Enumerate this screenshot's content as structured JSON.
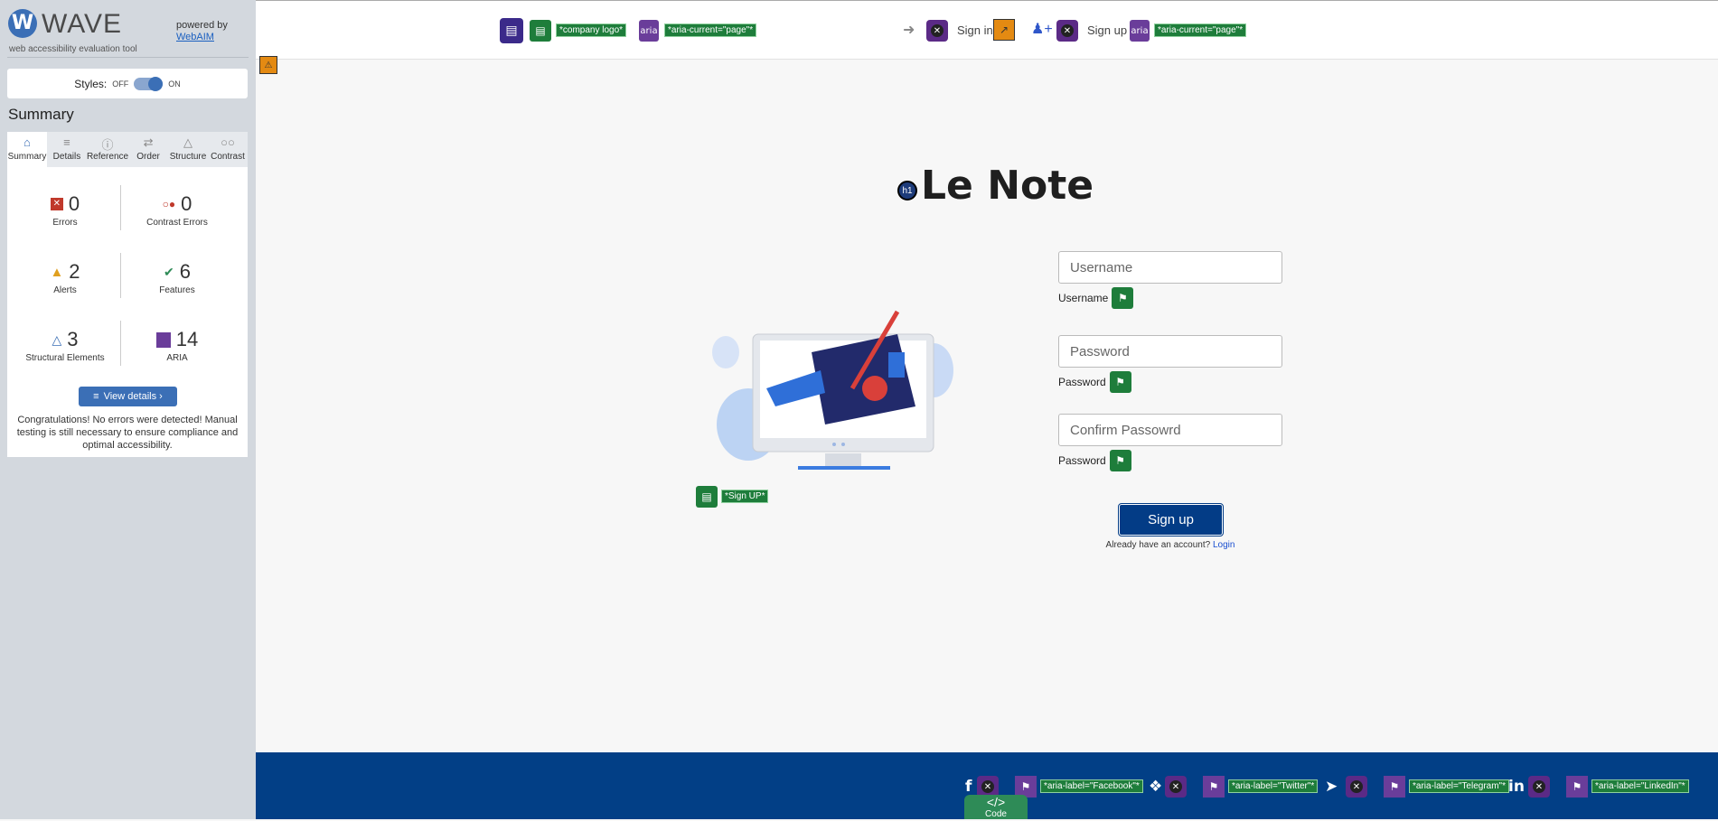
{
  "wave": {
    "title": "WAVE",
    "tagline": "web accessibility evaluation tool",
    "powered_by": "powered by",
    "webaim": "WebAIM",
    "styles_label": "Styles:",
    "styles_off": "OFF",
    "styles_on": "ON",
    "summary_heading": "Summary",
    "tabs": [
      {
        "label": "Summary",
        "icon": "home-icon"
      },
      {
        "label": "Details",
        "icon": "list-icon"
      },
      {
        "label": "Reference",
        "icon": "info-icon"
      },
      {
        "label": "Order",
        "icon": "order-icon"
      },
      {
        "label": "Structure",
        "icon": "structure-icon"
      },
      {
        "label": "Contrast",
        "icon": "contrast-icon"
      }
    ],
    "stats": {
      "errors": {
        "count": "0",
        "label": "Errors",
        "color": "#c0392b"
      },
      "contrast_errors": {
        "count": "0",
        "label": "Contrast Errors",
        "color": "#c0392b"
      },
      "alerts": {
        "count": "2",
        "label": "Alerts",
        "color": "#e0a020"
      },
      "features": {
        "count": "6",
        "label": "Features",
        "color": "#2e8b57"
      },
      "structural": {
        "count": "3",
        "label": "Structural Elements",
        "color": "#3b6fb6"
      },
      "aria": {
        "count": "14",
        "label": "ARIA",
        "color": "#6a3d9a"
      }
    },
    "view_details": "View details ›",
    "congrats": "Congratulations! No errors were detected! Manual testing is still necessary to ensure compliance and optimal accessibility."
  },
  "nav": {
    "logo_label": "*company logo*",
    "aria_current_1": "*aria-current=\"page\"*",
    "sign_in": "Sign in",
    "sign_up": "Sign up",
    "aria_current_2": "*aria-current=\"page\"*",
    "aria_badge": "aria"
  },
  "main": {
    "title": "Le Note",
    "h1_badge": "h1",
    "image_alt_label": "*Sign UP*",
    "username_placeholder": "Username",
    "username_label": "Username",
    "password_placeholder": "Password",
    "password_label": "Password",
    "confirm_placeholder": "Confirm Passowrd",
    "confirm_label": "Password",
    "submit_label": "Sign up",
    "already": "Already have an account?",
    "login_link": "Login"
  },
  "footer": {
    "facebook_label": "*aria-label=\"Facebook\"*",
    "twitter_label": "*aria-label=\"Twitter\"*",
    "telegram_label": "*aria-label=\"Telegram\"*",
    "linkedin_label": "*aria-label=\"LinkedIn\"*",
    "code_label": "</>",
    "code_text": "Code"
  }
}
